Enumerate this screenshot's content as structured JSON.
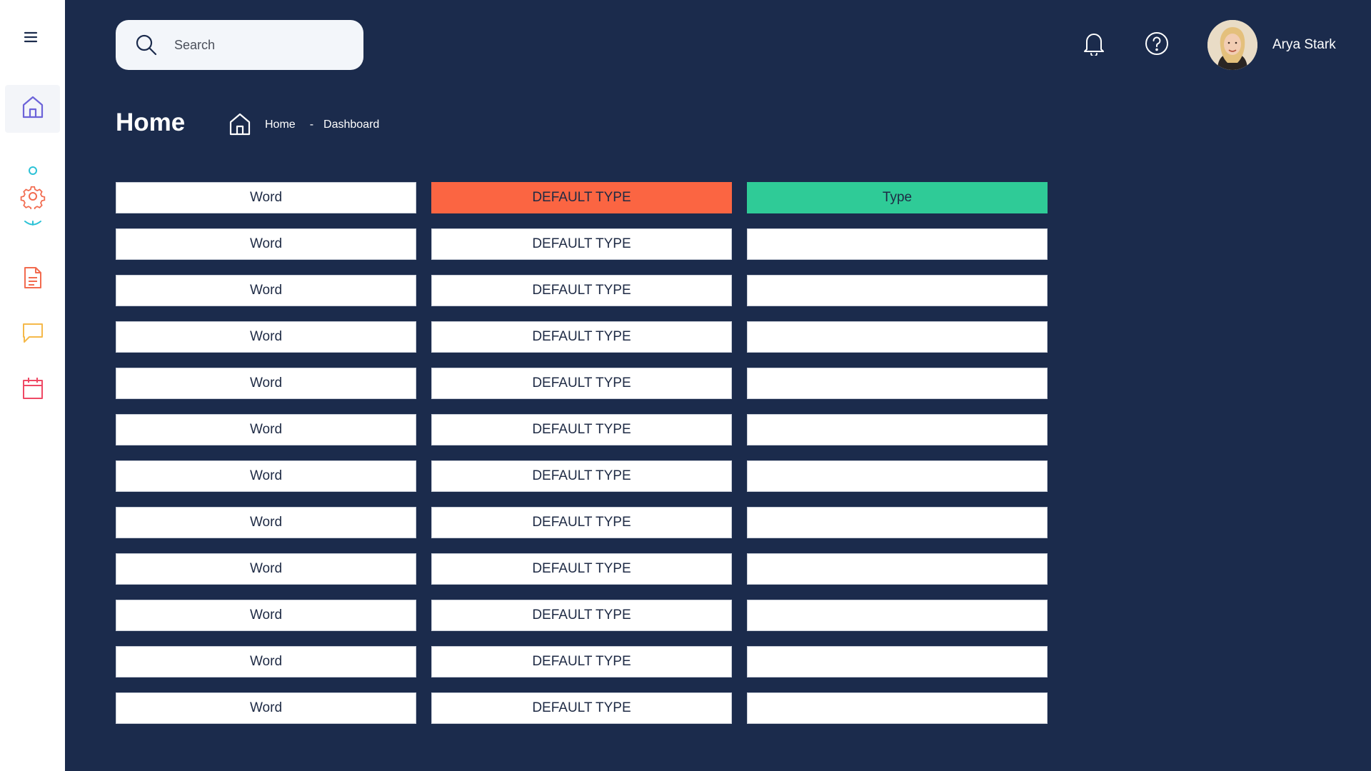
{
  "colors": {
    "background": "#1b2b4c",
    "sidebar": "#ffffff",
    "accent_orange": "#fb6542",
    "accent_green": "#2fcb97",
    "icon_home": "#6c63d9",
    "icon_settings": "#f26b4f",
    "icon_teal": "#2cc2d6",
    "icon_document": "#f26b4f",
    "icon_chat": "#f5b94a",
    "icon_calendar": "#ef4965"
  },
  "sidebar": {
    "items": [
      {
        "icon": "menu-icon"
      },
      {
        "icon": "home-icon"
      },
      {
        "icon": "gear-icon"
      },
      {
        "icon": "document-icon"
      },
      {
        "icon": "chat-icon"
      },
      {
        "icon": "calendar-icon"
      }
    ]
  },
  "search": {
    "placeholder": "Search"
  },
  "header": {
    "icons": [
      "bell-icon",
      "help-icon"
    ],
    "user": {
      "name": "Arya Stark"
    }
  },
  "page": {
    "title": "Home",
    "breadcrumb": {
      "home": "Home",
      "separator": "-",
      "current": "Dashboard"
    }
  },
  "table": {
    "rows": [
      [
        "Word",
        "DEFAULT TYPE",
        "Type"
      ],
      [
        "Word",
        "DEFAULT TYPE",
        ""
      ],
      [
        "Word",
        "DEFAULT TYPE",
        ""
      ],
      [
        "Word",
        "DEFAULT TYPE",
        ""
      ],
      [
        "Word",
        "DEFAULT TYPE",
        ""
      ],
      [
        "Word",
        "DEFAULT TYPE",
        ""
      ],
      [
        "Word",
        "DEFAULT TYPE",
        ""
      ],
      [
        "Word",
        "DEFAULT TYPE",
        ""
      ],
      [
        "Word",
        "DEFAULT TYPE",
        ""
      ],
      [
        "Word",
        "DEFAULT TYPE",
        ""
      ],
      [
        "Word",
        "DEFAULT TYPE",
        ""
      ],
      [
        "Word",
        "DEFAULT TYPE",
        ""
      ]
    ]
  }
}
